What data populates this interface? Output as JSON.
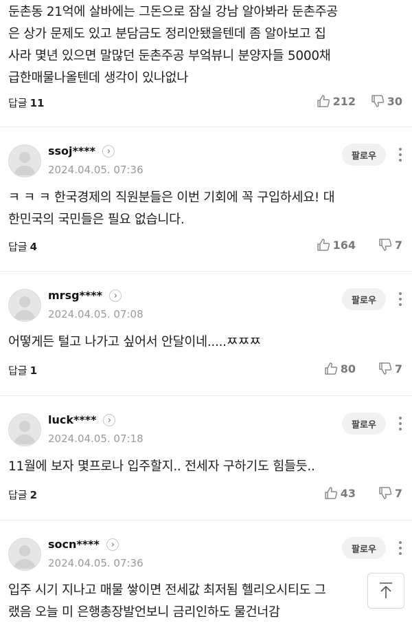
{
  "first_comment": {
    "lines": [
      "둔촌동 21억에 살바에는 그돈으로 잠실 강남 알아봐라 둔촌주공",
      "은 상가 문제도 있고 분담금도 정리안됐을텐데 좀 알아보고 집",
      "사라 몇년 있으면 말많던 둔촌주공 부엌뷰니 분양자들 5000채",
      "급한매물나올텐데 생각이 있나없나"
    ],
    "reply_label": "답글",
    "reply_count": "11",
    "likes": "212",
    "dislikes": "30"
  },
  "comments": [
    {
      "username": "ssoj****",
      "date": "2024.04.05. 07:36",
      "follow_label": "팔로우",
      "lines": [
        "ㅋ ㅋ ㅋ 한국경제의 직원분들은 이번 기회에 꼭 구입하세요! 대",
        "한민국의 국민들은 필요 없습니다."
      ],
      "reply_label": "답글",
      "reply_count": "4",
      "likes": "164",
      "dislikes": "7"
    },
    {
      "username": "mrsg****",
      "date": "2024.04.05. 07:08",
      "follow_label": "팔로우",
      "lines": [
        "어떻게든 털고 나가고 싶어서 안달이네.....ㅉㅉㅉ"
      ],
      "reply_label": "답글",
      "reply_count": "1",
      "likes": "80",
      "dislikes": "7"
    },
    {
      "username": "luck****",
      "date": "2024.04.05. 07:18",
      "follow_label": "팔로우",
      "lines": [
        "11월에 보자 몇프로나 입주할지.. 전세자 구하기도 힘들듯.."
      ],
      "reply_label": "답글",
      "reply_count": "2",
      "likes": "43",
      "dislikes": "7"
    },
    {
      "username": "socn****",
      "date": "2024.04.05. 07:36",
      "follow_label": "팔로우",
      "lines": [
        "입주 시기 지나고 매물 쌓이면 전세값 최저됨 헬리오시티도 그",
        "랬음 오늘 미 은행총장발언보니 금리인하도 물건너감"
      ]
    }
  ],
  "icons": {
    "like": "thumbs-up-icon",
    "dislike": "thumbs-down-icon",
    "more": "more-vertical-icon",
    "profile_arrow": "chevron-right-icon",
    "scroll_top": "arrow-up-icon"
  },
  "colors": {
    "text": "#1e1e1e",
    "muted": "#9a9a9a",
    "counts": "#7a7a7a",
    "follow_bg": "#f1f1f1",
    "divider": "#ebebeb"
  }
}
